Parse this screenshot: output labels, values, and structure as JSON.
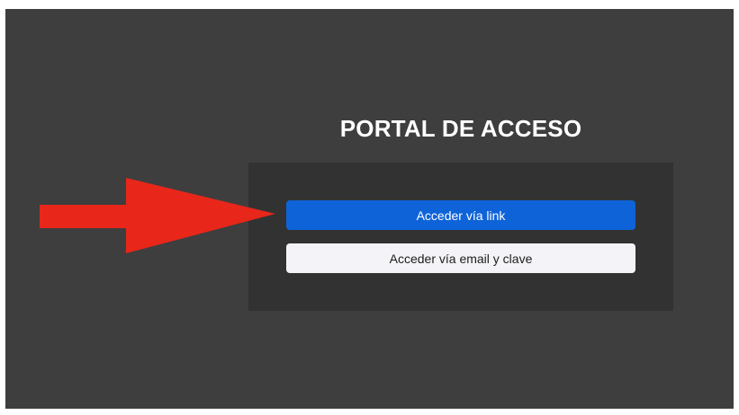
{
  "portal": {
    "title": "PORTAL DE ACCESO",
    "buttons": {
      "link_label": "Acceder vía link",
      "email_label": "Acceder vía email y clave"
    }
  },
  "annotation": {
    "icon": "red-arrow-icon",
    "color": "#e8261a"
  },
  "colors": {
    "background": "#3e3e3e",
    "panel": "#323232",
    "primary_button": "#0e63d9",
    "secondary_button": "#f4f4f8"
  }
}
